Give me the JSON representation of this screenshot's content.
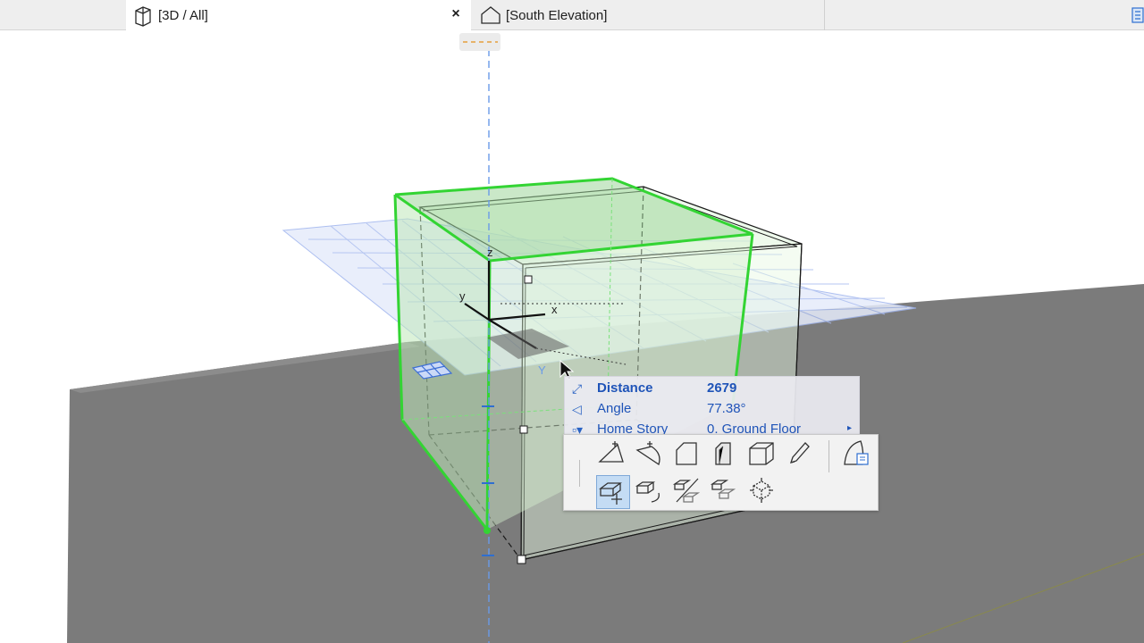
{
  "tabs": [
    {
      "label": "[3D / All]",
      "active": true,
      "icon": "3d-view-icon"
    },
    {
      "label": "[South Elevation]",
      "active": false,
      "icon": "elevation-icon"
    }
  ],
  "tab_close_glyph": "×",
  "viewport": {
    "axis_labels": {
      "z": "z",
      "y": "y",
      "x": "x",
      "y_upper": "Y"
    },
    "colors": {
      "slab": "#7a7a7a",
      "selection_green": "#32d332",
      "ghost_fill": "#dff3da",
      "grid": "#9fb4ee",
      "orbit_axis": "#4a86e8"
    }
  },
  "tracker": {
    "rows": [
      {
        "icon": "distance-icon",
        "label": "Distance",
        "value": "2679",
        "bold": true
      },
      {
        "icon": "angle-icon",
        "label": "Angle",
        "value": "77.38°",
        "bold": false
      },
      {
        "icon": "home-story-icon",
        "label": "Home Story",
        "value": "0. Ground Floor",
        "bold": false,
        "has_arrow": true
      }
    ],
    "arrow_glyph": "▸"
  },
  "pet_palette": {
    "row1": [
      "add-vertex-icon",
      "arc-edge-icon",
      "offset-edge-icon",
      "curved-edge-icon",
      "push-pull-icon",
      "custom-edit-icon"
    ],
    "row1_extra": "morph-settings-icon",
    "row2": [
      "drag-icon",
      "rotate-icon",
      "mirror-icon",
      "multiply-icon",
      "elevate-icon"
    ],
    "selected": "drag-icon"
  }
}
